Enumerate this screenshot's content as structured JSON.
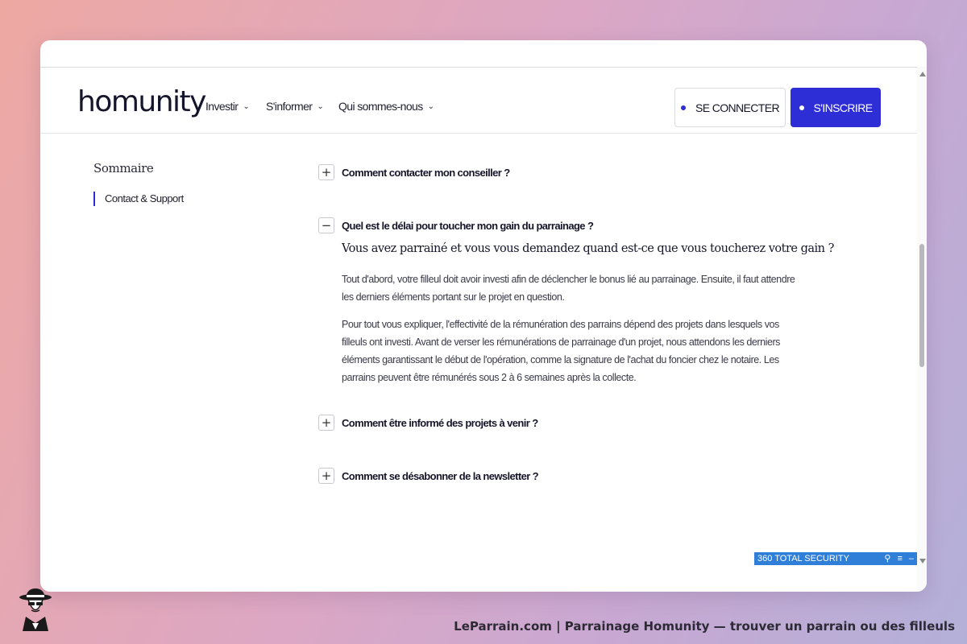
{
  "header": {
    "logo": "homunity",
    "nav": [
      {
        "label": "Investir"
      },
      {
        "label": "S'informer"
      },
      {
        "label": "Qui sommes-nous"
      }
    ],
    "login_label": "SE CONNECTER",
    "signup_label": "S'INSCRIRE",
    "chevron_icon": "chevron-down-icon",
    "accent_color": "#2e2ed6"
  },
  "sidebar": {
    "title": "Sommaire",
    "items": [
      {
        "label": "Contact & Support",
        "active": true
      }
    ]
  },
  "faq": [
    {
      "question": "Comment contacter mon conseiller ?",
      "expanded": false,
      "toggle": "+"
    },
    {
      "question": "Quel est le délai pour toucher mon gain du parrainage ?",
      "expanded": true,
      "toggle": "−"
    },
    {
      "question": "Comment être informé des projets à venir ?",
      "expanded": false,
      "toggle": "+"
    },
    {
      "question": "Comment se désabonner de la newsletter ?",
      "expanded": false,
      "toggle": "+"
    }
  ],
  "answer": {
    "title": "Vous avez parrainé et vous vous demandez quand est-ce que vous toucherez votre gain ?",
    "paragraph1": "Tout d'abord, votre filleul doit avoir investi afin de déclencher le bonus lié au parrainage. Ensuite, il faut attendre les derniers éléments portant sur le projet en question.",
    "paragraph2": "Pour tout vous expliquer, l'effectivité de la rémunération des parrains dépend des projets dans lesquels vos filleuls ont investi. Avant de verser les rémunérations de parrainage d'un projet, nous attendons les derniers éléments garantissant le début de l'opération, comme la signature de l'achat du foncier chez le notaire. Les parrains peuvent être rémunérés sous 2 à 6 semaines après la collecte."
  },
  "security_bar": {
    "label": "360 TOTAL SECURITY",
    "icons": [
      "search-icon",
      "menu-icon",
      "minimize-icon"
    ]
  },
  "footer": {
    "caption": "LeParrain.com | Parrainage Homunity — trouver un parrain ou des filleuls"
  }
}
